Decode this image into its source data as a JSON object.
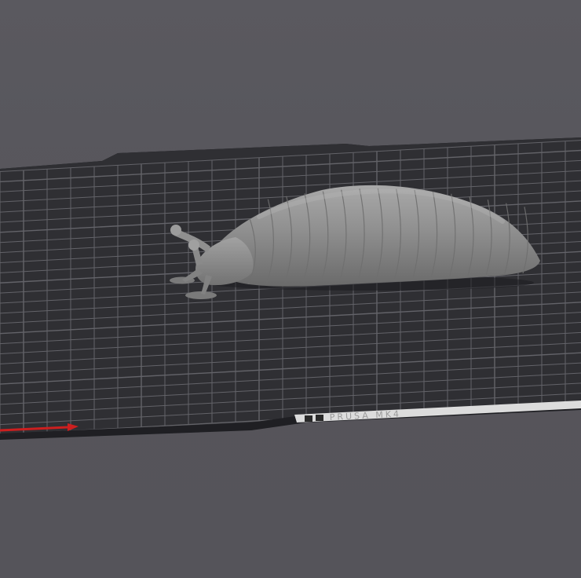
{
  "app": {
    "view": "3d-viewport"
  },
  "bed": {
    "label": "PRUSA MK4",
    "label_visible_style": "embossed",
    "surface_color": "#2f2f33",
    "edge_color": "#1f1f23",
    "grid_color": "#6d6d73",
    "strip_color": "#dcdcdc"
  },
  "model": {
    "name_icon": "slug-model",
    "color": "#8e8e8e"
  },
  "axes": {
    "x_axis_color": "#cc1f1f"
  },
  "colors": {
    "background": "#55545a"
  }
}
